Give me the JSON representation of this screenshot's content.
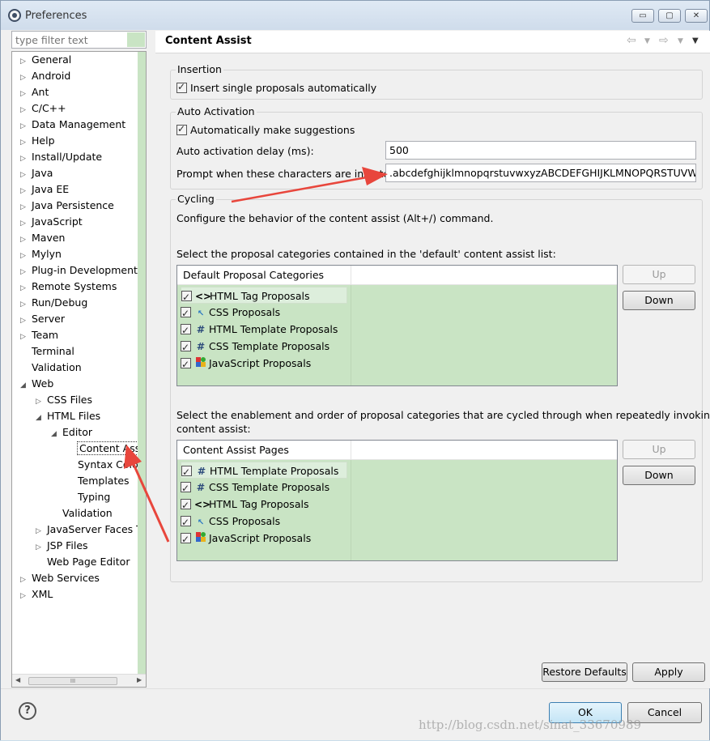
{
  "window": {
    "title": "Preferences",
    "buttons": {
      "minimize": "▭",
      "maximize": "▢",
      "close": "✕"
    }
  },
  "filter": {
    "placeholder": "type filter text"
  },
  "tree": {
    "items": [
      {
        "label": "General",
        "depth": 0,
        "arrow": "▷"
      },
      {
        "label": "Android",
        "depth": 0,
        "arrow": "▷"
      },
      {
        "label": "Ant",
        "depth": 0,
        "arrow": "▷"
      },
      {
        "label": "C/C++",
        "depth": 0,
        "arrow": "▷"
      },
      {
        "label": "Data Management",
        "depth": 0,
        "arrow": "▷"
      },
      {
        "label": "Help",
        "depth": 0,
        "arrow": "▷"
      },
      {
        "label": "Install/Update",
        "depth": 0,
        "arrow": "▷"
      },
      {
        "label": "Java",
        "depth": 0,
        "arrow": "▷"
      },
      {
        "label": "Java EE",
        "depth": 0,
        "arrow": "▷"
      },
      {
        "label": "Java Persistence",
        "depth": 0,
        "arrow": "▷"
      },
      {
        "label": "JavaScript",
        "depth": 0,
        "arrow": "▷"
      },
      {
        "label": "Maven",
        "depth": 0,
        "arrow": "▷"
      },
      {
        "label": "Mylyn",
        "depth": 0,
        "arrow": "▷"
      },
      {
        "label": "Plug-in Development",
        "depth": 0,
        "arrow": "▷"
      },
      {
        "label": "Remote Systems",
        "depth": 0,
        "arrow": "▷"
      },
      {
        "label": "Run/Debug",
        "depth": 0,
        "arrow": "▷"
      },
      {
        "label": "Server",
        "depth": 0,
        "arrow": "▷"
      },
      {
        "label": "Team",
        "depth": 0,
        "arrow": "▷"
      },
      {
        "label": "Terminal",
        "depth": 0,
        "arrow": ""
      },
      {
        "label": "Validation",
        "depth": 0,
        "arrow": ""
      },
      {
        "label": "Web",
        "depth": 0,
        "arrow": "◢"
      },
      {
        "label": "CSS Files",
        "depth": 1,
        "arrow": "▷"
      },
      {
        "label": "HTML Files",
        "depth": 1,
        "arrow": "◢"
      },
      {
        "label": "Editor",
        "depth": 2,
        "arrow": "◢"
      },
      {
        "label": "Content Assist",
        "depth": 3,
        "arrow": "",
        "selected": true
      },
      {
        "label": "Syntax Coloring",
        "depth": 3,
        "arrow": ""
      },
      {
        "label": "Templates",
        "depth": 3,
        "arrow": ""
      },
      {
        "label": "Typing",
        "depth": 3,
        "arrow": ""
      },
      {
        "label": "Validation",
        "depth": 2,
        "arrow": ""
      },
      {
        "label": "JavaServer Faces Tools",
        "depth": 1,
        "arrow": "▷"
      },
      {
        "label": "JSP Files",
        "depth": 1,
        "arrow": "▷"
      },
      {
        "label": "Web Page Editor",
        "depth": 1,
        "arrow": ""
      },
      {
        "label": "Web Services",
        "depth": 0,
        "arrow": "▷"
      },
      {
        "label": "XML",
        "depth": 0,
        "arrow": "▷"
      }
    ],
    "scroll_thumb": "III"
  },
  "page": {
    "title": "Content Assist",
    "insertion": {
      "legend": "Insertion",
      "insert_single": "Insert single proposals automatically"
    },
    "auto_activation": {
      "legend": "Auto Activation",
      "make_suggestions": "Automatically make suggestions",
      "delay_label": "Auto activation delay (ms):",
      "delay_value": "500",
      "prompt_label": "Prompt when these characters are inserted:",
      "prompt_value": ".abcdefghijklmnopqrstuvwxyzABCDEFGHIJKLMNOPQRSTUVW"
    },
    "cycling": {
      "legend": "Cycling",
      "description": "Configure the behavior of the content assist (Alt+/) command.",
      "default_list_label": "Select the proposal categories contained in the 'default' content assist list:",
      "default_table": {
        "header": "Default Proposal Categories",
        "rows": [
          {
            "icon": "<>",
            "label": "HTML Tag Proposals"
          },
          {
            "icon": "css",
            "label": "CSS Proposals"
          },
          {
            "icon": "#",
            "label": "HTML Template Proposals"
          },
          {
            "icon": "#",
            "label": "CSS Template Proposals"
          },
          {
            "icon": "js",
            "label": "JavaScript Proposals"
          }
        ]
      },
      "cycle_label_1": "Select the enablement and order of proposal categories that are cycled through when repeatedly invoking",
      "cycle_label_2": "content assist:",
      "pages_table": {
        "header": "Content Assist Pages",
        "rows": [
          {
            "icon": "#",
            "label": "HTML Template Proposals"
          },
          {
            "icon": "#",
            "label": "CSS Template Proposals"
          },
          {
            "icon": "<>",
            "label": "HTML Tag Proposals"
          },
          {
            "icon": "css",
            "label": "CSS Proposals"
          },
          {
            "icon": "js",
            "label": "JavaScript Proposals"
          }
        ]
      },
      "up_label": "Up",
      "down_label": "Down"
    },
    "restore_defaults": "Restore Defaults",
    "apply": "Apply"
  },
  "dialog": {
    "ok": "OK",
    "cancel": "Cancel",
    "help": "?"
  },
  "watermark": "http://blog.csdn.net/sinat_33670989",
  "colors": {
    "accent_green": "#c9e4c4",
    "annotation_red": "#e8463c",
    "ok_blue": "#3c7fb1"
  }
}
